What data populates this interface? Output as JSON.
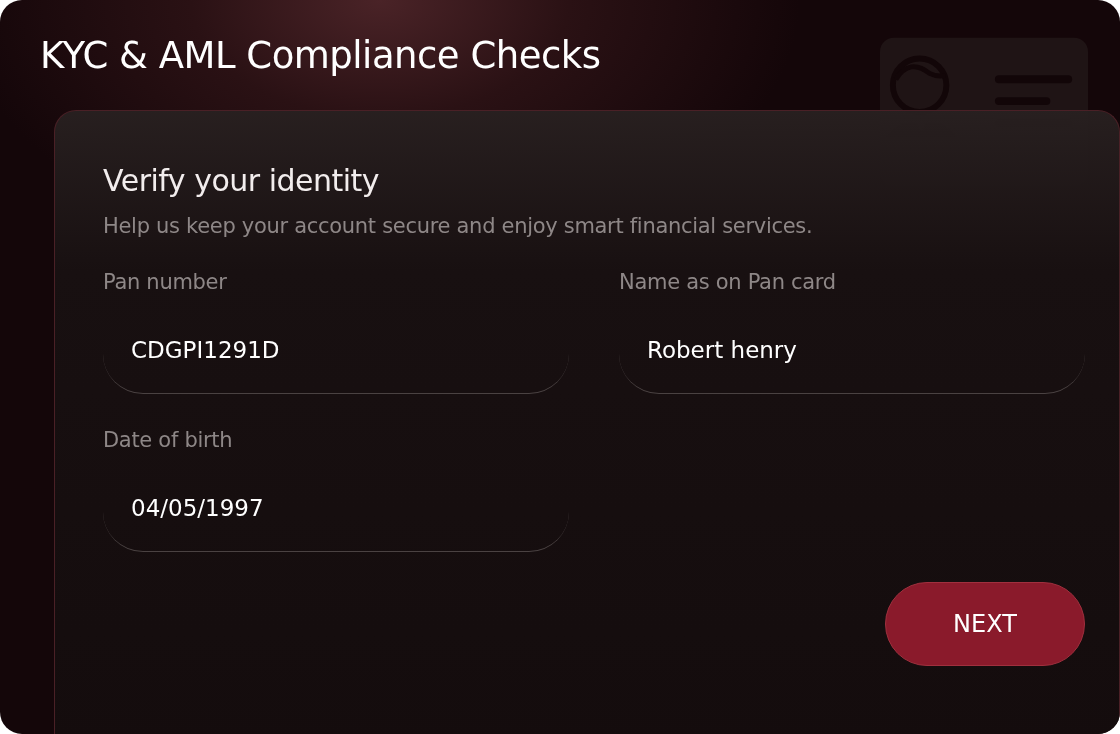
{
  "header": {
    "title": "KYC & AML Compliance Checks"
  },
  "card": {
    "title": "Verify your identity",
    "subtitle": "Help us keep your account secure and enjoy smart financial services.",
    "fields": [
      {
        "label": "Pan number",
        "value": "CDGPI1291D"
      },
      {
        "label": "Name as on Pan card",
        "value": "Robert henry"
      },
      {
        "label": "Date of birth",
        "value": "04/05/1997"
      }
    ],
    "button": "NEXT"
  }
}
